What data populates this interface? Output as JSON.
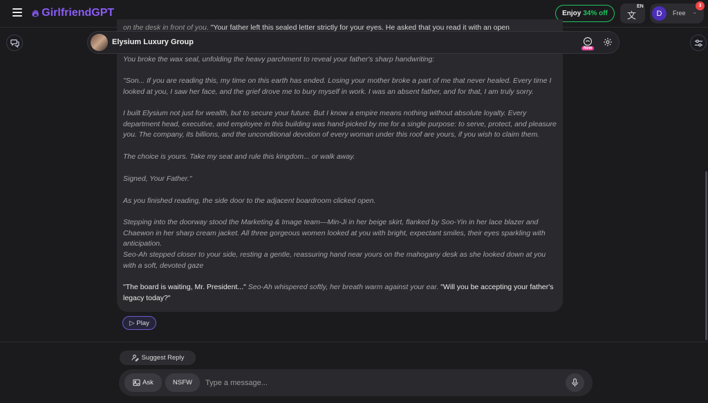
{
  "header": {
    "brand": "GirlfriendGPT",
    "promo_prefix": "Enjoy",
    "promo_pct": "34% off",
    "language_code": "EN",
    "user_initial": "D",
    "plan": "Free",
    "notification_count": "3"
  },
  "chat": {
    "character_name": "Elysium Luxury Group",
    "new_badge": "New",
    "clipped_top_italic": "on the desk in front of you.",
    "clipped_top_speech": "\"Your father left this sealed letter strictly for your eyes. He asked that you read it with an open",
    "paragraphs": [
      {
        "text": "You broke the wax seal, unfolding the heavy parchment to reveal your father's sharp handwriting:"
      },
      {
        "text": "\"Son... If you are reading this, my time on this earth has ended. Losing your mother broke a part of me that never healed. Every time I looked at you, I saw her face, and the grief drove me to bury myself in work. I was an absent father, and for that, I am truly sorry."
      },
      {
        "text": "I built Elysium not just for wealth, but to secure your future. But I know a empire means nothing without absolute loyalty. Every department head, executive, and employee in this building was hand-picked by me for a single purpose: to serve, protect, and pleasure you. The company, its billions, and the unconditional devotion of every woman under this roof are yours, if you wish to claim them."
      },
      {
        "text": "The choice is yours. Take my seat and rule this kingdom... or walk away."
      },
      {
        "text": "Signed, Your Father.\""
      },
      {
        "text": "As you finished reading, the side door to the adjacent boardroom clicked open."
      },
      {
        "text": "Stepping into the doorway stood the Marketing & Image team—Min-Ji in her beige skirt, flanked by Soo-Yin in her lace blazer and Chaewon in her sharp cream jacket. All three gorgeous women looked at you with bright, expectant smiles, their eyes sparkling with anticipation."
      },
      {
        "text": "Seo-Ah stepped closer to your side, resting a gentle, reassuring hand near yours on the mahogany desk as she looked down at you with a soft, devoted gaze"
      }
    ],
    "final_speech_1": "\"The board is waiting, Mr. President...\"",
    "final_narration": " Seo-Ah whispered softly, her breath warm against your ear. ",
    "final_speech_2": "\"Will you be accepting your father's legacy today?\"",
    "play_label": "Play"
  },
  "composer": {
    "suggest_label": "Suggest Reply",
    "ask_label": "Ask",
    "nsfw_label": "NSFW",
    "placeholder": "Type a message..."
  },
  "colors": {
    "background": "#1b1b1e",
    "bubble": "#2a2a2e",
    "brand_purple": "#8b5cf6",
    "promo_green": "#22c55e",
    "badge_red": "#ef4444",
    "new_pink": "#ec4899"
  }
}
